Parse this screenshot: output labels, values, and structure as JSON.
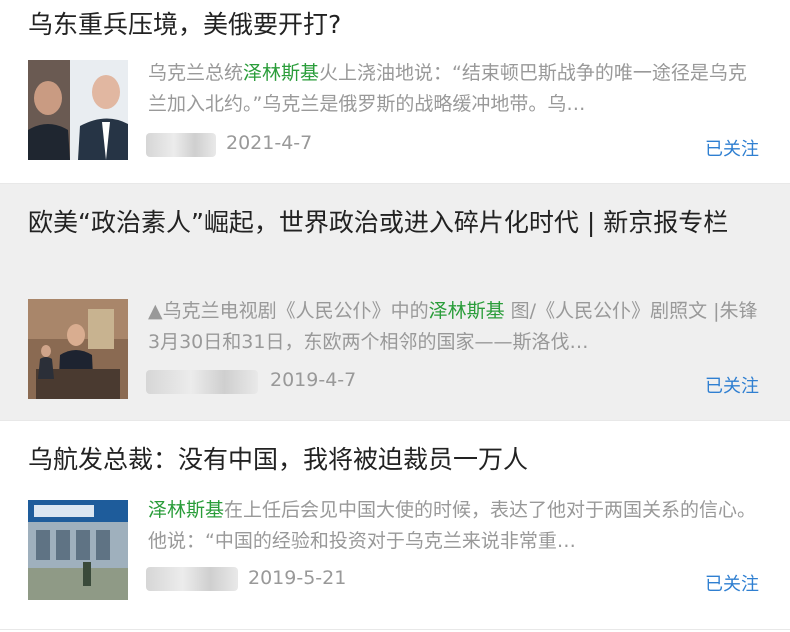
{
  "articles": [
    {
      "title": "乌东重兵压境，美俄要开打?",
      "snippet_pre": "乌克兰总统",
      "snippet_kw": "泽林斯基",
      "snippet_post": "火上浇油地说：“结束顿巴斯战争的唯一途径是乌克兰加入北约。”乌克兰是俄罗斯的战略缓冲地带。乌…",
      "date": "2021-4-7",
      "follow": "已关注"
    },
    {
      "title": "欧美“政治素人”崛起，世界政治或进入碎片化时代 | 新京报专栏",
      "snippet_pre": "▲乌克兰电视剧《人民公仆》中的",
      "snippet_kw": "泽林斯基",
      "snippet_post": " 图/《人民公仆》剧照文 |朱锋3月30日和31日，东欧两个相邻的国家——斯洛伐…",
      "date": "2019-4-7",
      "follow": "已关注"
    },
    {
      "title": "乌航发总裁：没有中国，我将被迫裁员一万人",
      "snippet_pre": "",
      "snippet_kw": "泽林斯基",
      "snippet_post": "在上任后会见中国大使的时候，表达了他对于两国关系的信心。他说：“中国的经验和投资对于乌克兰来说非常重…",
      "date": "2019-5-21",
      "follow": "已关注"
    }
  ]
}
